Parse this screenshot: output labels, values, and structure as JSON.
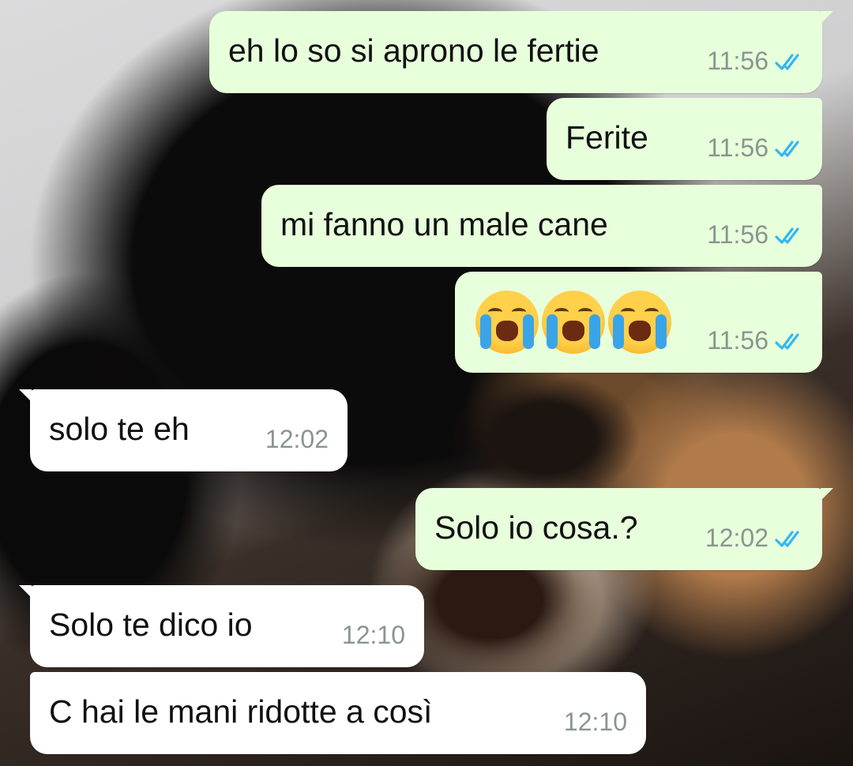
{
  "messages": [
    {
      "text": "eh lo so si aprono le fertie",
      "time": "11:56"
    },
    {
      "text": "Ferite",
      "time": "11:56"
    },
    {
      "text": "mi fanno un male cane",
      "time": "11:56"
    },
    {
      "emoji": [
        "loudly-crying-face",
        "loudly-crying-face",
        "loudly-crying-face"
      ],
      "time": "11:56"
    },
    {
      "text": "solo te eh",
      "time": "12:02"
    },
    {
      "text": "Solo io cosa.?",
      "time": "12:02"
    },
    {
      "text": "Solo te dico io",
      "time": "12:10"
    },
    {
      "text": "C hai le mani ridotte a così",
      "time": "12:10"
    }
  ],
  "colors": {
    "outgoing_bubble": "#e7ffdb",
    "incoming_bubble": "#ffffff",
    "read_ticks": "#34b7f1",
    "timestamp": "#8a9590"
  },
  "icons": {
    "read_receipt": "double-check-icon"
  }
}
